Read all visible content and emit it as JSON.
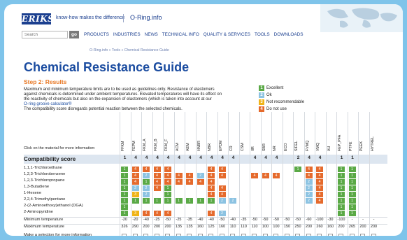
{
  "header": {
    "logo_text": "ERIKS",
    "tagline": "know-how makes the difference",
    "site_name": "O-Ring.info"
  },
  "nav": {
    "search_placeholder": "Search",
    "go_label": "go",
    "items": [
      "PRODUCTS",
      "INDUSTRIES",
      "NEWS",
      "TECHNICAL INFO",
      "QUALITY & SERVICES",
      "TOOLS",
      "DOWNLOADS"
    ]
  },
  "breadcrumb": "O-Ring.info » Tools » Chemical Resistance Guide",
  "page_title": "Chemical Resistance Guide",
  "step_title": "Step 2: Results",
  "paragraphs": [
    "Maximum and minimum temperature limits are to be used as guidelines only. Resistance of elastomers",
    "against chemicals is determined under ambient temperatures. Elevated temperatures will have its effect on",
    "the reactivity of chemicals but also on the expansion of elastomers (which is taken into account at our",
    "O-ring groove calculator®",
    "The compatibility score disregards potential reaction between the selected chemicals."
  ],
  "legend": [
    {
      "num": "1",
      "label": "Excellent",
      "color": "#5aa946"
    },
    {
      "num": "2",
      "label": "Ok",
      "color": "#8cc3e2"
    },
    {
      "num": "3",
      "label": "Not recommendable",
      "color": "#f0b418"
    },
    {
      "num": "4",
      "label": "Do not use",
      "color": "#e56a2c"
    }
  ],
  "table": {
    "click_label": "Click on the material for more information:",
    "compat_label": "Compatibility score",
    "materials": [
      "FFKM",
      "FEPM",
      "FKM_A",
      "FKM_B",
      "FKM_F",
      "ACM",
      "AEM",
      "HNBR",
      "NBR",
      "EPDM",
      "CR",
      "CSM",
      "IIR",
      "SBR",
      "NR",
      "ECO",
      "SIFEL",
      "FVMQ",
      "VMQ",
      "AU",
      "FEP_PFA",
      "PTFE",
      "PEEK",
      "HYTREL"
    ],
    "scores": [
      "1",
      "4",
      "4",
      "4",
      "4",
      "4",
      "4",
      "4",
      "4",
      "4",
      "4",
      "",
      "4",
      "4",
      "4",
      "",
      "2",
      "4",
      "4",
      "",
      "1",
      "1",
      "",
      ""
    ],
    "chemicals": [
      {
        "name": "1,1,1-Trichloroethane",
        "cells": [
          "g",
          "o",
          "o",
          "o",
          "o",
          "",
          "",
          "",
          "o",
          "o",
          "",
          "",
          "",
          "",
          "",
          "",
          "g",
          "o",
          "o",
          "",
          "g",
          "g",
          "",
          ""
        ]
      },
      {
        "name": "1,2,3-Trichlorobenzene",
        "cells": [
          "g",
          "o",
          "b",
          "o",
          "o",
          "o",
          "o",
          "b",
          "o",
          "o",
          "",
          "",
          "o",
          "o",
          "o",
          "",
          "",
          "o",
          "o",
          "",
          "g",
          "g",
          "",
          ""
        ]
      },
      {
        "name": "1,2,3-Trichloropropane",
        "cells": [
          "g",
          "o",
          "g",
          "o",
          "o",
          "o",
          "o",
          "o",
          "o",
          "",
          "",
          "",
          "",
          "",
          "",
          "",
          "",
          "b",
          "o",
          "",
          "g",
          "g",
          "",
          ""
        ]
      },
      {
        "name": "1,3-Butadiene",
        "cells": [
          "g",
          "b",
          "b",
          "o",
          "g",
          "",
          "",
          "",
          "o",
          "o",
          "",
          "",
          "",
          "",
          "",
          "",
          "",
          "b",
          "o",
          "",
          "g",
          "g",
          "",
          ""
        ]
      },
      {
        "name": "1-Hexene",
        "cells": [
          "g",
          "y",
          "b",
          "",
          "g",
          "",
          "",
          "",
          "o",
          "o",
          "",
          "",
          "",
          "",
          "",
          "",
          "",
          "b",
          "o",
          "",
          "g",
          "g",
          "",
          ""
        ]
      },
      {
        "name": "2,2,4-Trimethylpentane",
        "cells": [
          "g",
          "g",
          "g",
          "g",
          "g",
          "g",
          "g",
          "g",
          "g",
          "b",
          "b",
          "",
          "",
          "",
          "",
          "",
          "",
          "b",
          "o",
          "",
          "g",
          "g",
          "",
          ""
        ]
      },
      {
        "name": "2-(2-Aminoethoxy)ethanol (DGA)",
        "cells": [
          "g",
          "",
          "",
          "",
          "",
          "",
          "",
          "",
          "",
          "",
          "",
          "",
          "",
          "",
          "",
          "",
          "",
          "",
          "",
          "",
          "g",
          "g",
          "",
          ""
        ]
      },
      {
        "name": "2-Aminopyridine",
        "cells": [
          "g",
          "y",
          "o",
          "o",
          "o",
          "",
          "",
          "",
          "o",
          "b",
          "",
          "",
          "",
          "",
          "",
          "",
          "",
          "",
          "",
          "",
          "g",
          "g",
          "",
          ""
        ]
      }
    ],
    "min_label": "Minimum temperature",
    "min_values": [
      "-20",
      "-20",
      "-40",
      "-25",
      "-50",
      "-25",
      "-35",
      "-40",
      "-40",
      "-50",
      "-40",
      "-35",
      "-50",
      "-50",
      "-50",
      "-50",
      "-50",
      "-60",
      "-100",
      "-30",
      "-100",
      "-",
      "-",
      "-"
    ],
    "max_label": "Maximum temperature",
    "max_values": [
      "326",
      "290",
      "200",
      "200",
      "200",
      "135",
      "135",
      "160",
      "125",
      "160",
      "110",
      "110",
      "110",
      "100",
      "100",
      "150",
      "250",
      "200",
      "260",
      "160",
      "200",
      "265",
      "200",
      "200"
    ],
    "select_label": "Make a selection for more information"
  }
}
